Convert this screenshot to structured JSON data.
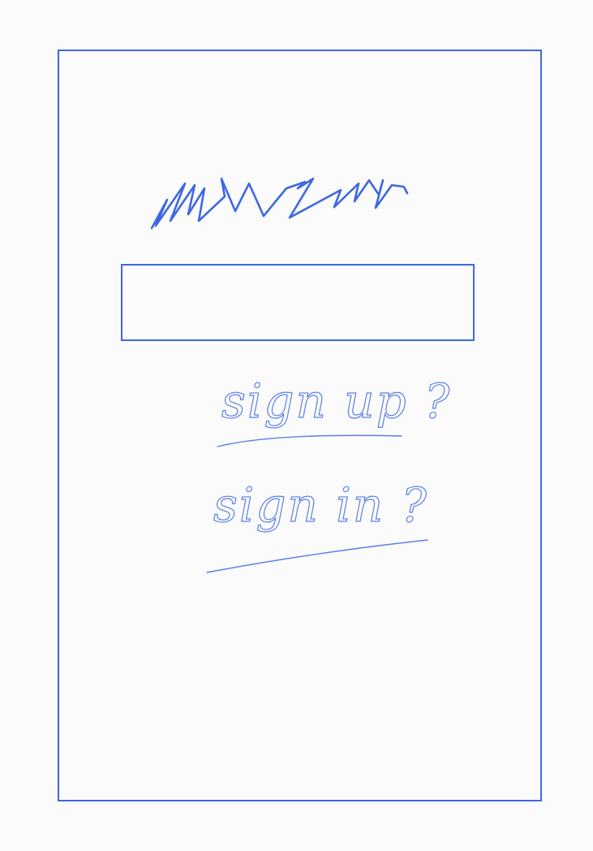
{
  "sketch": {
    "title_scribble": "",
    "input_field": {
      "value": "",
      "placeholder": ""
    },
    "links": {
      "signup_label": "sign up ?",
      "signin_label": "sign in ?"
    }
  },
  "colors": {
    "stroke": "#3F68E0",
    "handwriting": "#5B7FE6",
    "background": "#FBFBFB"
  }
}
